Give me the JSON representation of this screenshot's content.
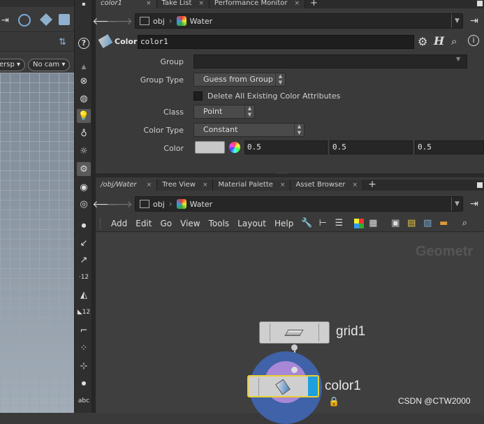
{
  "viewport": {
    "persp_label": "ersp",
    "cam_label": "No cam"
  },
  "param_pane": {
    "tabs": [
      {
        "label": "color1"
      },
      {
        "label": "Take List"
      },
      {
        "label": "Performance Monitor"
      }
    ],
    "path": {
      "root": "obj",
      "node": "Water"
    },
    "node_type": "Color",
    "node_name": "color1",
    "params": {
      "group_label": "Group",
      "group_value": "",
      "group_type_label": "Group Type",
      "group_type_value": "Guess from Group",
      "delete_label": "Delete All Existing Color Attributes",
      "class_label": "Class",
      "class_value": "Point",
      "color_type_label": "Color Type",
      "color_type_value": "Constant",
      "color_label": "Color",
      "color_r": "0.5",
      "color_g": "0.5",
      "color_b": "0.5",
      "swatch_color": "#c8c8c8"
    }
  },
  "network_pane": {
    "tabs": [
      {
        "label": "/obj/Water"
      },
      {
        "label": "Tree View"
      },
      {
        "label": "Material Palette"
      },
      {
        "label": "Asset Browser"
      }
    ],
    "path": {
      "root": "obj",
      "node": "Water"
    },
    "menu": [
      "Add",
      "Edit",
      "Go",
      "View",
      "Tools",
      "Layout",
      "Help"
    ],
    "context_label": "Geometr",
    "nodes": [
      {
        "name": "grid1"
      },
      {
        "name": "color1"
      }
    ]
  },
  "watermark": "CSDN @CTW2000"
}
